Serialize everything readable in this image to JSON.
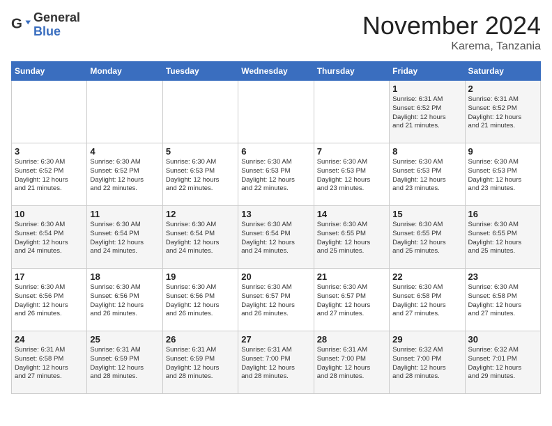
{
  "header": {
    "logo_general": "General",
    "logo_blue": "Blue",
    "month_title": "November 2024",
    "location": "Karema, Tanzania"
  },
  "days_of_week": [
    "Sunday",
    "Monday",
    "Tuesday",
    "Wednesday",
    "Thursday",
    "Friday",
    "Saturday"
  ],
  "weeks": [
    [
      {
        "day": "",
        "info": ""
      },
      {
        "day": "",
        "info": ""
      },
      {
        "day": "",
        "info": ""
      },
      {
        "day": "",
        "info": ""
      },
      {
        "day": "",
        "info": ""
      },
      {
        "day": "1",
        "info": "Sunrise: 6:31 AM\nSunset: 6:52 PM\nDaylight: 12 hours\nand 21 minutes."
      },
      {
        "day": "2",
        "info": "Sunrise: 6:31 AM\nSunset: 6:52 PM\nDaylight: 12 hours\nand 21 minutes."
      }
    ],
    [
      {
        "day": "3",
        "info": "Sunrise: 6:30 AM\nSunset: 6:52 PM\nDaylight: 12 hours\nand 21 minutes."
      },
      {
        "day": "4",
        "info": "Sunrise: 6:30 AM\nSunset: 6:52 PM\nDaylight: 12 hours\nand 22 minutes."
      },
      {
        "day": "5",
        "info": "Sunrise: 6:30 AM\nSunset: 6:53 PM\nDaylight: 12 hours\nand 22 minutes."
      },
      {
        "day": "6",
        "info": "Sunrise: 6:30 AM\nSunset: 6:53 PM\nDaylight: 12 hours\nand 22 minutes."
      },
      {
        "day": "7",
        "info": "Sunrise: 6:30 AM\nSunset: 6:53 PM\nDaylight: 12 hours\nand 23 minutes."
      },
      {
        "day": "8",
        "info": "Sunrise: 6:30 AM\nSunset: 6:53 PM\nDaylight: 12 hours\nand 23 minutes."
      },
      {
        "day": "9",
        "info": "Sunrise: 6:30 AM\nSunset: 6:53 PM\nDaylight: 12 hours\nand 23 minutes."
      }
    ],
    [
      {
        "day": "10",
        "info": "Sunrise: 6:30 AM\nSunset: 6:54 PM\nDaylight: 12 hours\nand 24 minutes."
      },
      {
        "day": "11",
        "info": "Sunrise: 6:30 AM\nSunset: 6:54 PM\nDaylight: 12 hours\nand 24 minutes."
      },
      {
        "day": "12",
        "info": "Sunrise: 6:30 AM\nSunset: 6:54 PM\nDaylight: 12 hours\nand 24 minutes."
      },
      {
        "day": "13",
        "info": "Sunrise: 6:30 AM\nSunset: 6:54 PM\nDaylight: 12 hours\nand 24 minutes."
      },
      {
        "day": "14",
        "info": "Sunrise: 6:30 AM\nSunset: 6:55 PM\nDaylight: 12 hours\nand 25 minutes."
      },
      {
        "day": "15",
        "info": "Sunrise: 6:30 AM\nSunset: 6:55 PM\nDaylight: 12 hours\nand 25 minutes."
      },
      {
        "day": "16",
        "info": "Sunrise: 6:30 AM\nSunset: 6:55 PM\nDaylight: 12 hours\nand 25 minutes."
      }
    ],
    [
      {
        "day": "17",
        "info": "Sunrise: 6:30 AM\nSunset: 6:56 PM\nDaylight: 12 hours\nand 26 minutes."
      },
      {
        "day": "18",
        "info": "Sunrise: 6:30 AM\nSunset: 6:56 PM\nDaylight: 12 hours\nand 26 minutes."
      },
      {
        "day": "19",
        "info": "Sunrise: 6:30 AM\nSunset: 6:56 PM\nDaylight: 12 hours\nand 26 minutes."
      },
      {
        "day": "20",
        "info": "Sunrise: 6:30 AM\nSunset: 6:57 PM\nDaylight: 12 hours\nand 26 minutes."
      },
      {
        "day": "21",
        "info": "Sunrise: 6:30 AM\nSunset: 6:57 PM\nDaylight: 12 hours\nand 27 minutes."
      },
      {
        "day": "22",
        "info": "Sunrise: 6:30 AM\nSunset: 6:58 PM\nDaylight: 12 hours\nand 27 minutes."
      },
      {
        "day": "23",
        "info": "Sunrise: 6:30 AM\nSunset: 6:58 PM\nDaylight: 12 hours\nand 27 minutes."
      }
    ],
    [
      {
        "day": "24",
        "info": "Sunrise: 6:31 AM\nSunset: 6:58 PM\nDaylight: 12 hours\nand 27 minutes."
      },
      {
        "day": "25",
        "info": "Sunrise: 6:31 AM\nSunset: 6:59 PM\nDaylight: 12 hours\nand 28 minutes."
      },
      {
        "day": "26",
        "info": "Sunrise: 6:31 AM\nSunset: 6:59 PM\nDaylight: 12 hours\nand 28 minutes."
      },
      {
        "day": "27",
        "info": "Sunrise: 6:31 AM\nSunset: 7:00 PM\nDaylight: 12 hours\nand 28 minutes."
      },
      {
        "day": "28",
        "info": "Sunrise: 6:31 AM\nSunset: 7:00 PM\nDaylight: 12 hours\nand 28 minutes."
      },
      {
        "day": "29",
        "info": "Sunrise: 6:32 AM\nSunset: 7:00 PM\nDaylight: 12 hours\nand 28 minutes."
      },
      {
        "day": "30",
        "info": "Sunrise: 6:32 AM\nSunset: 7:01 PM\nDaylight: 12 hours\nand 29 minutes."
      }
    ]
  ]
}
